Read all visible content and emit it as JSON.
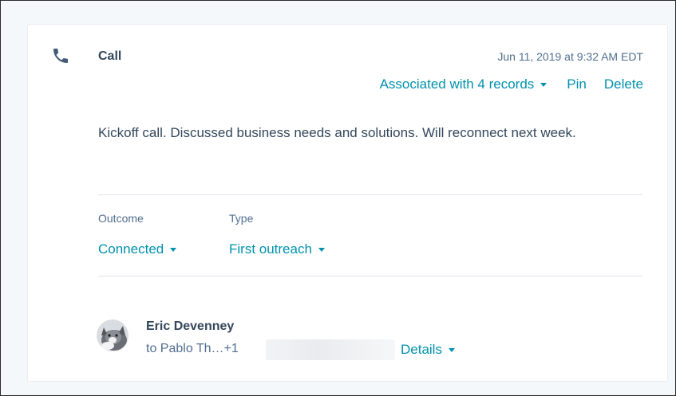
{
  "engagement": {
    "type_label": "Call",
    "timestamp": "Jun 11, 2019 at 9:32 AM EDT",
    "associations_label": "Associated with 4 records",
    "pin_label": "Pin",
    "delete_label": "Delete",
    "body": "Kickoff call. Discussed business needs and solutions. Will reconnect next week."
  },
  "fields": {
    "outcome": {
      "label": "Outcome",
      "value": "Connected"
    },
    "type": {
      "label": "Type",
      "value": "First outreach"
    }
  },
  "contact": {
    "name": "Eric Devenney",
    "to_text": "to Pablo Th…+1",
    "details_label": "Details"
  },
  "colors": {
    "link": "#0091ae",
    "text": "#33475b",
    "muted": "#516f90"
  },
  "icons": {
    "call": "phone-icon"
  }
}
